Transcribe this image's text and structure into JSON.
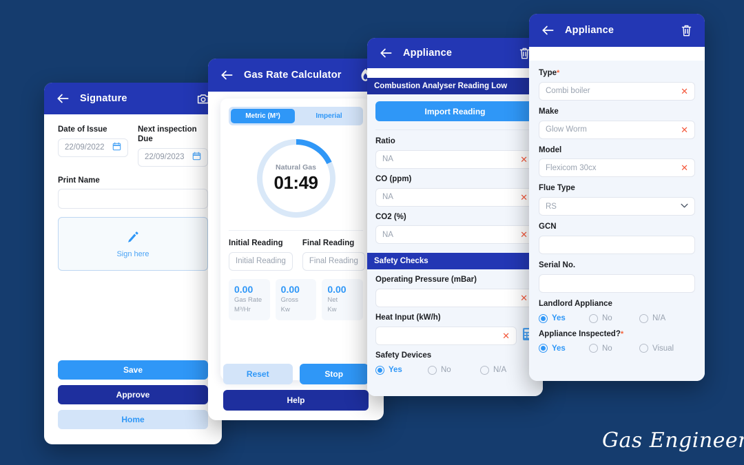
{
  "theme": {
    "background": "#153C6E",
    "header_blue": "#2337B4",
    "accent_blue": "#2F97F7",
    "navy": "#1E2F9E",
    "pale_blue": "#D3E4F9",
    "panel_bg": "#F2F6FC",
    "required_red": "#F4643C"
  },
  "brand": {
    "name": "Gas Engineer"
  },
  "signature_panel": {
    "title": "Signature",
    "back_icon": "arrow-left-icon",
    "camera_icon": "camera-icon",
    "date_of_issue": {
      "label": "Date of Issue",
      "value": "22/09/2022",
      "icon": "calendar-icon"
    },
    "next_inspection": {
      "label": "Next inspection Due",
      "value": "22/09/2023",
      "icon": "calendar-icon"
    },
    "print_name": {
      "label": "Print Name",
      "value": ""
    },
    "sign_area": {
      "label": "Sign here",
      "icon": "pen-icon"
    },
    "buttons": [
      {
        "label": "Save",
        "style": "light-blue"
      },
      {
        "label": "Approve",
        "style": "navy"
      },
      {
        "label": "Home",
        "style": "pale"
      }
    ]
  },
  "gas_rate_panel": {
    "title": "Gas Rate Calculator",
    "back_icon": "arrow-left-icon",
    "flame_icon": "flame-icon",
    "tabs": [
      {
        "label": "Metric (M³)",
        "active": true
      },
      {
        "label": "Imperial",
        "active": false
      }
    ],
    "gauge": {
      "name": "Natural Gas",
      "time": "01:49",
      "progress_percent": 18,
      "track_color": "#D9E8F8",
      "arc_color": "#2F97F7"
    },
    "initial_reading": {
      "label": "Initial Reading",
      "placeholder": "Initial Reading",
      "value": ""
    },
    "final_reading": {
      "label": "Final Reading",
      "placeholder": "Final Reading",
      "value": ""
    },
    "stats": [
      {
        "value": "0.00",
        "name": "Gas Rate",
        "unit": "M³/Hr"
      },
      {
        "value": "0.00",
        "name": "Gross",
        "unit": "Kw"
      },
      {
        "value": "0.00",
        "name": "Net",
        "unit": "Kw"
      }
    ],
    "buttons": [
      {
        "label": "Reset",
        "style": "pale"
      },
      {
        "label": "Stop",
        "style": "light-blue"
      },
      {
        "label": "Help",
        "style": "navy"
      }
    ]
  },
  "combustion_panel": {
    "title": "Appliance",
    "back_icon": "arrow-left-icon",
    "delete_icon": "trash-icon",
    "section_title": "Combustion Analyser Reading Low",
    "import_button": "Import Reading",
    "fields": [
      {
        "label": "Ratio",
        "value": "NA",
        "clear_icon": "clear-x-icon"
      },
      {
        "label": "CO (ppm)",
        "value": "NA",
        "clear_icon": "clear-x-icon"
      },
      {
        "label": "CO2 (%)",
        "value": "NA",
        "clear_icon": "clear-x-icon"
      }
    ],
    "safety_section_title": "Safety Checks",
    "operating_pressure": {
      "label": "Operating Pressure (mBar)",
      "value": "",
      "clear_icon": "clear-x-icon"
    },
    "heat_input": {
      "label": "Heat Input (kW/h)",
      "value": "",
      "clear_icon": "clear-x-icon",
      "calculator_icon": "calculator-icon"
    },
    "safety_devices": {
      "label": "Safety Devices",
      "options": [
        {
          "label": "Yes",
          "selected": true
        },
        {
          "label": "No",
          "selected": false
        },
        {
          "label": "N/A",
          "selected": false
        }
      ]
    }
  },
  "appliance_panel": {
    "title": "Appliance",
    "back_icon": "arrow-left-icon",
    "delete_icon": "trash-icon",
    "type": {
      "label": "Type",
      "required": "*",
      "value": "Combi boiler",
      "clear_icon": "clear-x-icon"
    },
    "make": {
      "label": "Make",
      "value": "Glow Worm",
      "clear_icon": "clear-x-icon"
    },
    "model": {
      "label": "Model",
      "value": "Flexicom 30cx",
      "clear_icon": "clear-x-icon"
    },
    "flue_type": {
      "label": "Flue Type",
      "value": "RS",
      "caret_icon": "chevron-down-icon"
    },
    "gcn": {
      "label": "GCN",
      "value": ""
    },
    "serial_no": {
      "label": "Serial No.",
      "value": ""
    },
    "landlord_appliance": {
      "label": "Landlord Appliance",
      "options": [
        {
          "label": "Yes",
          "selected": true
        },
        {
          "label": "No",
          "selected": false
        },
        {
          "label": "N/A",
          "selected": false
        }
      ]
    },
    "appliance_inspected": {
      "label": "Appliance Inspected?",
      "required": "*",
      "options": [
        {
          "label": "Yes",
          "selected": true
        },
        {
          "label": "No",
          "selected": false
        },
        {
          "label": "Visual",
          "selected": false
        }
      ]
    }
  }
}
